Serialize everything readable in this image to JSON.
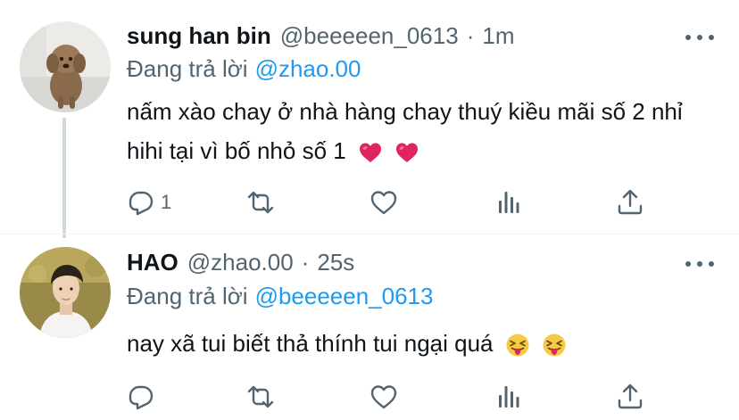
{
  "tweets": [
    {
      "name": "sung han bin",
      "handle": "@beeeeen_0613",
      "separator": "·",
      "time": "1m",
      "reply_prefix": "Đang trả lời",
      "reply_to": "@zhao.00",
      "text": "nấm xào chay ở nhà hàng chay thuý kiều mãi số 2 nhỉ hihi tại vì bố nhỏ số 1",
      "emojis": [
        "red-heart",
        "red-heart"
      ],
      "reply_count": "1",
      "avatar": "poodle-dog-photo"
    },
    {
      "name": "HAO",
      "handle": "@zhao.00",
      "separator": "·",
      "time": "25s",
      "reply_prefix": "Đang trả lời",
      "reply_to": "@beeeeen_0613",
      "text": "nay xã tui biết thả thính tui ngại quá",
      "emojis": [
        "squinting-tongue-face",
        "squinting-tongue-face"
      ],
      "reply_count": "",
      "avatar": "young-man-photo"
    }
  ],
  "icons": [
    "reply-icon",
    "retweet-icon",
    "like-icon",
    "views-icon",
    "share-icon",
    "more-icon"
  ],
  "colors": {
    "text": "#0f1419",
    "secondary": "#536471",
    "link": "#1d9bf0",
    "thread_line": "#cfd9de"
  }
}
